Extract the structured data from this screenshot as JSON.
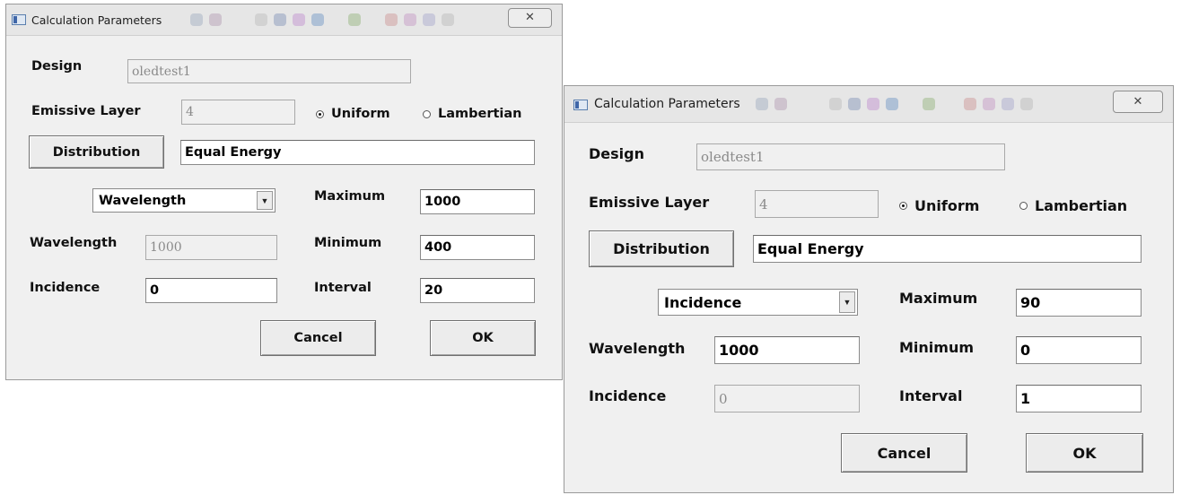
{
  "dialogs": [
    {
      "title": "Calculation Parameters",
      "close_glyph": "✕",
      "design_label": "Design",
      "design_value": "oledtest1",
      "emissive_label": "Emissive Layer",
      "emissive_value": "4",
      "radio_uniform": "Uniform",
      "radio_lambertian": "Lambertian",
      "selected_radio": "Uniform",
      "distribution_button": "Distribution",
      "distribution_value": "Equal Energy",
      "mode_select": "Wavelength",
      "maximum_label": "Maximum",
      "maximum_value": "1000",
      "wavelength_label": "Wavelength",
      "wavelength_value": "1000",
      "wavelength_enabled": false,
      "minimum_label": "Minimum",
      "minimum_value": "400",
      "incidence_label": "Incidence",
      "incidence_value": "0",
      "incidence_enabled": true,
      "interval_label": "Interval",
      "interval_value": "20",
      "cancel_button": "Cancel",
      "ok_button": "OK"
    },
    {
      "title": "Calculation Parameters",
      "close_glyph": "✕",
      "design_label": "Design",
      "design_value": "oledtest1",
      "emissive_label": "Emissive Layer",
      "emissive_value": "4",
      "radio_uniform": "Uniform",
      "radio_lambertian": "Lambertian",
      "selected_radio": "Uniform",
      "distribution_button": "Distribution",
      "distribution_value": "Equal Energy",
      "mode_select": "Incidence",
      "maximum_label": "Maximum",
      "maximum_value": "90",
      "wavelength_label": "Wavelength",
      "wavelength_value": "1000",
      "wavelength_enabled": true,
      "minimum_label": "Minimum",
      "minimum_value": "0",
      "incidence_label": "Incidence",
      "incidence_value": "0",
      "incidence_enabled": false,
      "interval_label": "Interval",
      "interval_value": "1",
      "cancel_button": "Cancel",
      "ok_button": "OK"
    }
  ],
  "colors": {
    "dialog_bg": "#f0f0f0",
    "disabled_text": "#8a8a8a",
    "titlebar": "#e6e6e6"
  }
}
